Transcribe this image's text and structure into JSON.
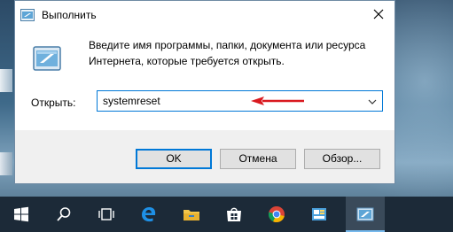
{
  "dialog": {
    "title": "Выполнить",
    "description": "Введите имя программы, папки, документа или ресурса Интернета, которые требуется открыть.",
    "open_label": "Открыть:",
    "open_value": "systemreset",
    "buttons": {
      "ok": "OK",
      "cancel": "Отмена",
      "browse": "Обзор..."
    }
  },
  "taskbar": {
    "items": [
      "windows-start-icon",
      "search-icon",
      "task-view-icon",
      "edge-icon",
      "file-explorer-icon",
      "store-icon",
      "chrome-icon",
      "control-panel-icon",
      "run-icon"
    ]
  },
  "colors": {
    "accent": "#0078d7",
    "annotation_arrow": "#d9191f",
    "taskbar": "#1c2a38"
  }
}
